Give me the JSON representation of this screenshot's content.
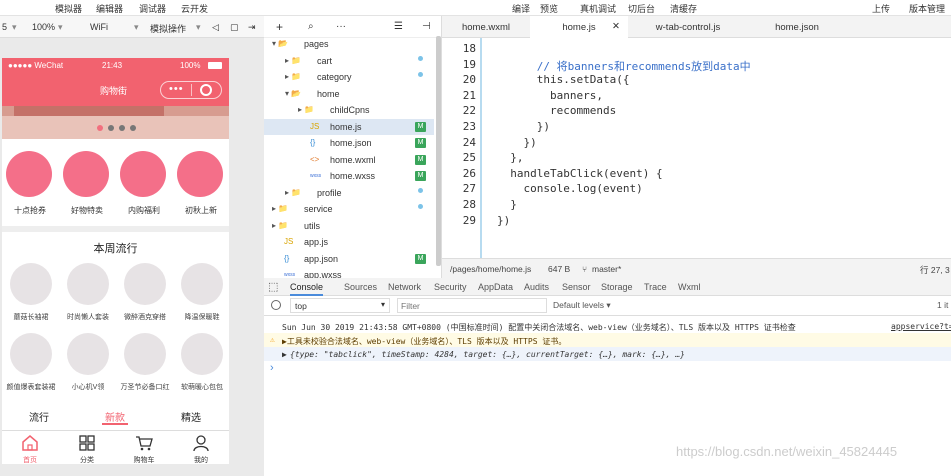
{
  "menubar": {
    "items": [
      "模拟器",
      "编辑器",
      "调试器",
      "云开发"
    ],
    "right": [
      "编译",
      "预览",
      "真机调试",
      "切后台",
      "清缓存"
    ],
    "far": [
      "上传",
      "版本管理"
    ]
  },
  "devbar": {
    "scale_prefix": "5",
    "zoom": "100%",
    "network": "WiFi",
    "mode": "模拟操作"
  },
  "phone": {
    "carrier": "●●●●● WeChat",
    "time": "21:43",
    "battery": "100%",
    "title": "购物街",
    "recommends": [
      "十点抢券",
      "好物特卖",
      "内购福利",
      "初秋上新"
    ],
    "popular_title": "本周流行",
    "popular_row1": [
      "蘑菇长袖裙",
      "时尚懒人套装",
      "微醉酒克穿搭",
      "降温保暖鞋"
    ],
    "popular_row2": [
      "颜值爆表套装裙",
      "小心机V领",
      "万圣节必备口红",
      "软萌暖心包包"
    ],
    "tabs": [
      "流行",
      "新款",
      "精选"
    ],
    "tabbar": [
      "首页",
      "分类",
      "购物车",
      "我的"
    ],
    "accent": "#f2626f"
  },
  "explorer": {
    "items": [
      {
        "label": "pages",
        "indent": 1,
        "icon": "folder-open"
      },
      {
        "label": "cart",
        "indent": 2,
        "icon": "folder"
      },
      {
        "label": "category",
        "indent": 2,
        "icon": "folder"
      },
      {
        "label": "home",
        "indent": 2,
        "icon": "folder-open"
      },
      {
        "label": "childCpns",
        "indent": 3,
        "icon": "folder"
      },
      {
        "label": "home.js",
        "indent": 3,
        "icon": "js",
        "badge": "M"
      },
      {
        "label": "home.json",
        "indent": 3,
        "icon": "json",
        "badge": "M"
      },
      {
        "label": "home.wxml",
        "indent": 3,
        "icon": "wxml",
        "badge": "M"
      },
      {
        "label": "home.wxss",
        "indent": 3,
        "icon": "wxss",
        "badge": "M"
      },
      {
        "label": "profile",
        "indent": 2,
        "icon": "folder"
      },
      {
        "label": "service",
        "indent": 1,
        "icon": "folder"
      },
      {
        "label": "utils",
        "indent": 1,
        "icon": "folder"
      },
      {
        "label": "app.js",
        "indent": 1,
        "icon": "js"
      },
      {
        "label": "app.json",
        "indent": 1,
        "icon": "json",
        "badge": "M"
      },
      {
        "label": "app.wxss",
        "indent": 1,
        "icon": "wxss"
      }
    ]
  },
  "editor": {
    "tabs": [
      "home.wxml",
      "home.js",
      "w-tab-control.js",
      "home.json"
    ],
    "active_tab": "home.js",
    "lines": [
      {
        "n": "18",
        "t": ""
      },
      {
        "n": "19",
        "t": "      // 将banners和recommends放到data中"
      },
      {
        "n": "20",
        "t": "      this.setData({"
      },
      {
        "n": "21",
        "t": "        banners,"
      },
      {
        "n": "22",
        "t": "        recommends"
      },
      {
        "n": "23",
        "t": "      })"
      },
      {
        "n": "24",
        "t": "    })"
      },
      {
        "n": "25",
        "t": "  },"
      },
      {
        "n": "26",
        "t": "  handleTabClick(event) {"
      },
      {
        "n": "27",
        "t": "    console.log(event)"
      },
      {
        "n": "28",
        "t": "  }"
      },
      {
        "n": "29",
        "t": "})"
      }
    ],
    "status_path": "/pages/home/home.js",
    "status_size": "647 B",
    "status_branch": "master*",
    "status_pos": "行 27, 3"
  },
  "devtools": {
    "tabs": [
      "Console",
      "Sources",
      "Network",
      "Security",
      "AppData",
      "Audits",
      "Sensor",
      "Storage",
      "Trace",
      "Wxml"
    ],
    "context": "top",
    "filter_placeholder": "Filter",
    "levels": "Default levels ▾",
    "count": "1 it",
    "log1": "Sun Jun 30 2019 21:43:58 GMT+0800 (中国标准时间) 配置中关闭合法域名、web-view（业务域名）、TLS 版本以及 HTTPS 证书检查",
    "log1_src": "appservice?t=",
    "warn": "▶工具未校验合法域名、web-view（业务域名）、TLS 版本以及 HTTPS 证书。",
    "obj": "{type: \"tabclick\", timeStamp: 4284, target: {…}, currentTarget: {…}, mark: {…}, …}",
    "prompt": "›"
  },
  "watermark": "https://blog.csdn.net/weixin_45824445"
}
